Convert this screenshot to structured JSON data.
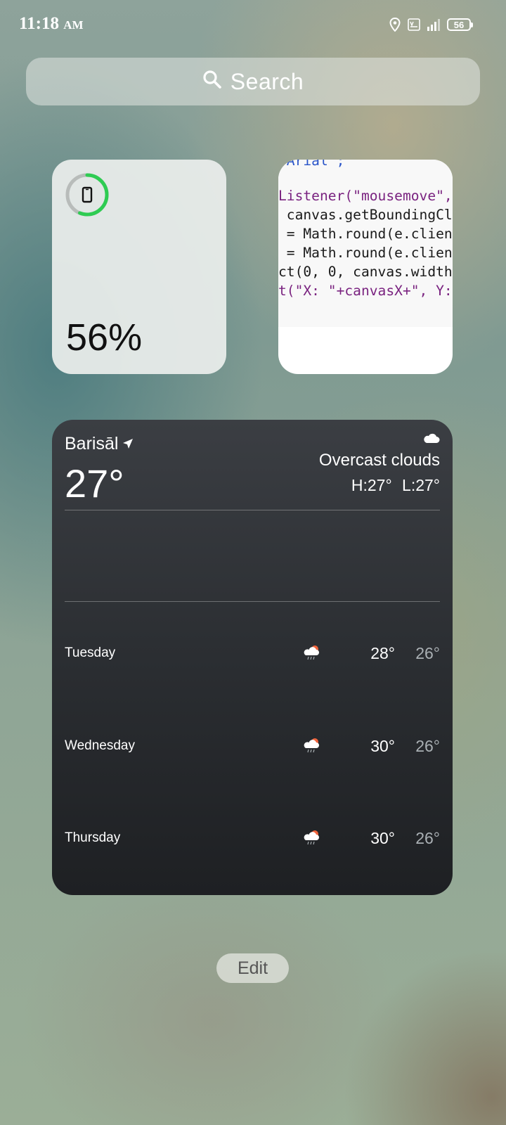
{
  "status_bar": {
    "time": "11:18",
    "meridiem": "AM",
    "icons": [
      "location-icon",
      "volte-icon",
      "signal-icon"
    ],
    "battery_level": "56"
  },
  "search": {
    "label": "Search",
    "icon": "search-icon"
  },
  "battery_widget": {
    "percent_text": "56%",
    "level": 0.56,
    "ring_color": "#2ecc52",
    "icon": "phone-icon"
  },
  "code_widget": {
    "lines": [
      "\"Arial\";",
      "Listener(\"mousemove\",",
      " canvas.getBoundingCl",
      " = Math.round(e.clien",
      " = Math.round(e.clien",
      "ct(0, 0, canvas.width",
      "t(\"X: \"+canvasX+\", Y:"
    ]
  },
  "weather": {
    "city": "Barisāl",
    "current_temp": "27°",
    "condition": "Overcast clouds",
    "high": "H:27°",
    "low": "L:27°",
    "condition_icon": "cloud-icon",
    "forecast": [
      {
        "day": "Tuesday",
        "high": "28°",
        "low": "26°",
        "icon": "rain-icon"
      },
      {
        "day": "Wednesday",
        "high": "30°",
        "low": "26°",
        "icon": "rain-icon"
      },
      {
        "day": "Thursday",
        "high": "30°",
        "low": "26°",
        "icon": "rain-icon"
      }
    ]
  },
  "edit_label": "Edit"
}
